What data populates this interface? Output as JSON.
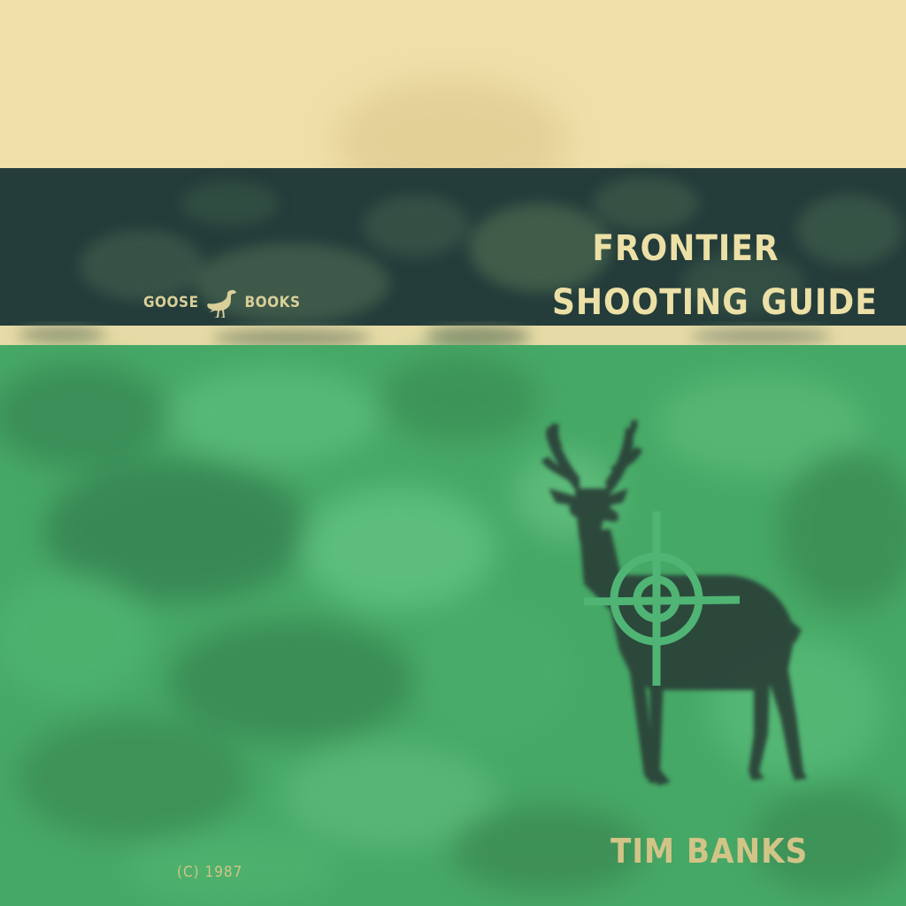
{
  "cover": {
    "title_line_1": "FRONTIER",
    "title_line_2": "SHOOTING GUIDE",
    "publisher_left": "GOOSE",
    "publisher_right": "BOOKS",
    "author": "TIM BANKS",
    "copyright": "(C) 1987"
  },
  "icons": {
    "publisher_logo": "goose-icon",
    "illustration": "deer-icon",
    "target": "crosshair-icon"
  },
  "colors": {
    "cream": "#efdfa8",
    "dark_band": "#243c3a",
    "green": "#46a866",
    "title_text": "#ece0a6",
    "deer": "#2b4038",
    "crosshair": "#4fb474"
  }
}
